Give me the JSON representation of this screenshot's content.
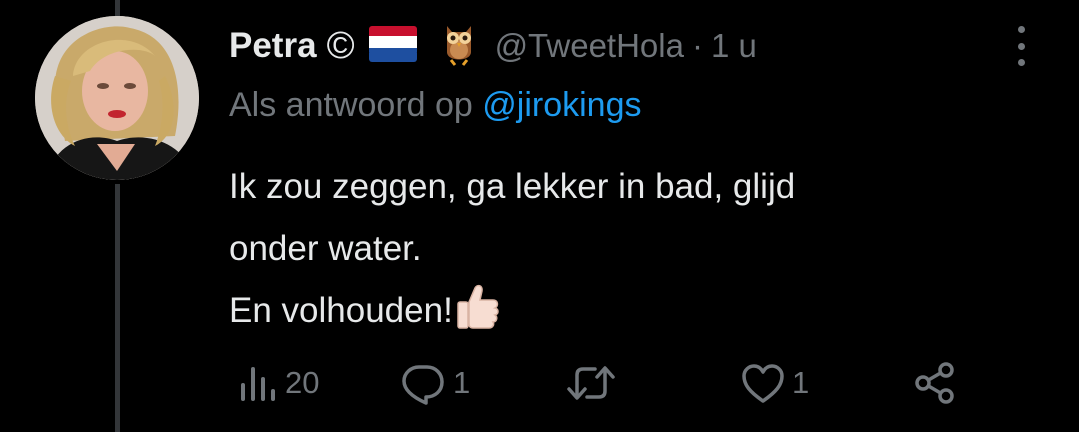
{
  "tweet": {
    "display_name": "Petra",
    "copyright_symbol": "©",
    "handle": "@TweetHola",
    "separator": "·",
    "time": "1 u",
    "reply_prefix": "Als antwoord op",
    "reply_to": "@jirokings",
    "text_lines": [
      "Ik zou zeggen, ga lekker in bad, glijd",
      "onder water.",
      "En volhouden!"
    ],
    "emoji_after_text": "thumbs-up-icon"
  },
  "actions": {
    "views": {
      "icon": "views-icon",
      "count": "20"
    },
    "reply": {
      "icon": "reply-icon",
      "count": "1"
    },
    "retweet": {
      "icon": "retweet-icon",
      "count": ""
    },
    "like": {
      "icon": "heart-icon",
      "count": "1"
    },
    "share": {
      "icon": "share-icon"
    }
  },
  "colors": {
    "background": "#000000",
    "primary_text": "#e7e9ea",
    "secondary_text": "#71767b",
    "link": "#1d9bf0",
    "thread_line": "#333639"
  }
}
